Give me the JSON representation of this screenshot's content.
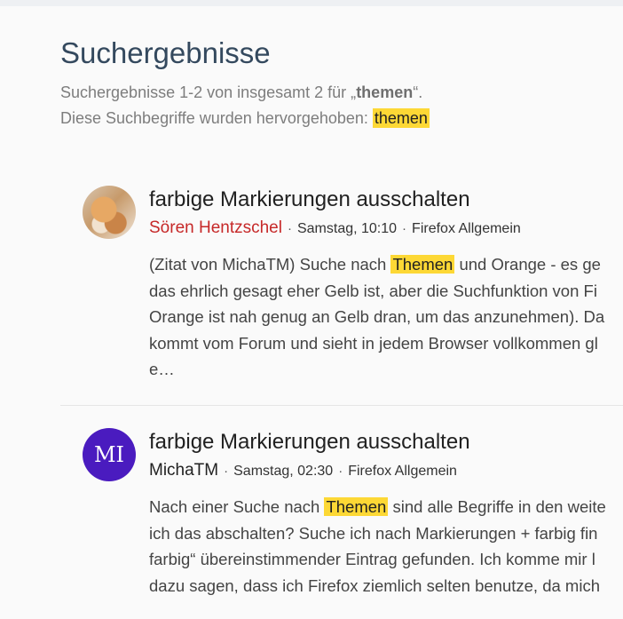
{
  "page": {
    "title": "Suchergebnisse",
    "summary_prefix": "Suchergebnisse 1-2 von insgesamt 2 für „",
    "summary_term": "themen",
    "summary_suffix": "“.",
    "highlight_label": "Diese Suchbegriffe wurden hervorgehoben: ",
    "highlight_term": "themen"
  },
  "colors": {
    "highlight": "#fdd835",
    "author_red": "#c62828",
    "title": "#34495e",
    "avatar_purple": "#4a1bbf"
  },
  "results": [
    {
      "title": "farbige Markierungen ausschalten",
      "author": "Sören Hentzschel",
      "date": "Samstag, 10:10",
      "forum": "Firefox Allgemein",
      "avatar": "cat-photo",
      "excerpt": {
        "l1_pre": "(Zitat von MichaTM) Suche nach ",
        "l1_hl": "Themen",
        "l1_post": " und Orange - es ge",
        "l2": "das ehrlich gesagt eher Gelb ist, aber die Suchfunktion von Fi",
        "l3": "Orange ist nah genug an Gelb dran, um das anzunehmen). Da",
        "l4": "kommt vom Forum und sieht in jedem Browser vollkommen gl",
        "l5": "e…"
      }
    },
    {
      "title": "farbige Markierungen ausschalten",
      "author": "MichaTM",
      "date": "Samstag, 02:30",
      "forum": "Firefox Allgemein",
      "avatar_initials": "MI",
      "excerpt": {
        "l1_pre": "Nach einer Suche nach ",
        "l1_hl": "Themen",
        "l1_post": " sind alle Begriffe in den weite",
        "l2": "ich das abschalten? Suche ich nach Markierungen + farbig fin",
        "l3": "farbig“ übereinstimmender Eintrag gefunden. Ich komme mir l",
        "l4": "dazu sagen, dass ich Firefox ziemlich selten benutze, da mich"
      }
    }
  ]
}
